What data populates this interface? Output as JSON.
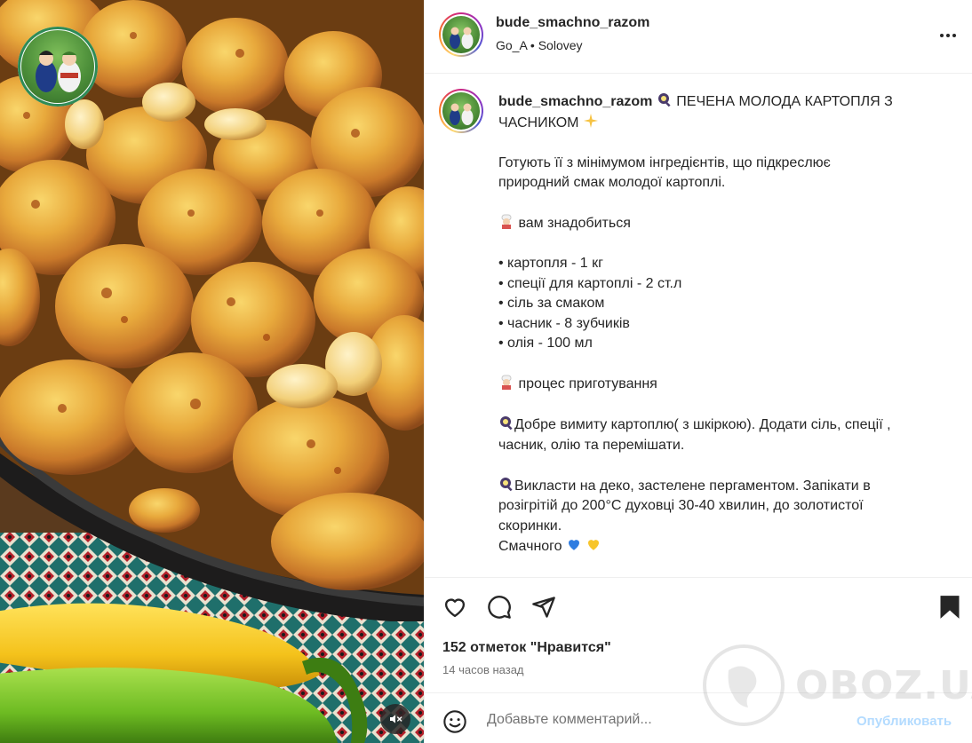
{
  "media": {
    "alt": "Печена молода картопля з часником",
    "mute_icon": "volume-off-icon"
  },
  "post": {
    "username": "bude_smachno_razom",
    "audio_artist": "Go_A",
    "audio_separator": "•",
    "audio_track": "Solovey",
    "more_icon": "more-horizontal-icon"
  },
  "caption": {
    "username": "bude_smachno_razom",
    "title": "ПЕЧЕНА МОЛОДА КАРТОПЛЯ З ЧАСНИКОМ",
    "intro_line1": "Готують її з мінімумом інгредієнтів, що підкреслює",
    "intro_line2": "природний смак молодої картоплі.",
    "need_heading": "вам знадобиться",
    "ingredients": [
      "• картопля - 1 кг",
      "• спеції для картоплі - 2 ст.л",
      "• сіль за смаком",
      "• часник - 8 зубчиків",
      "• олія - 100 мл"
    ],
    "process_heading": "процес приготування",
    "step1_line1": "Добре вимиту картоплю( з шкіркою). Додати сіль, спеції ,",
    "step1_line2": "часник, олію та перемішати.",
    "step2_line1": "Викласти на деко, застелене пергаментом. Запікати в",
    "step2_line2": "розігрітій до 200°С духовці 30-40 хвилин, до золотистої",
    "step2_line3": "скоринки.",
    "closing": "Смачного"
  },
  "actions": {
    "like_icon": "heart-icon",
    "comment_icon": "comment-icon",
    "share_icon": "share-icon",
    "save_icon": "bookmark-icon",
    "likes_text": "152 отметок \"Нравится\"",
    "time_ago": "14 часов назад"
  },
  "comment": {
    "placeholder": "Добавьте комментарий...",
    "post_label": "Опубликовать"
  },
  "watermark": {
    "text": "OBOZ.UA"
  },
  "colors": {
    "text": "#262626",
    "muted": "#737373",
    "divider": "#efefef",
    "post_button_disabled": "#b3dbff"
  }
}
